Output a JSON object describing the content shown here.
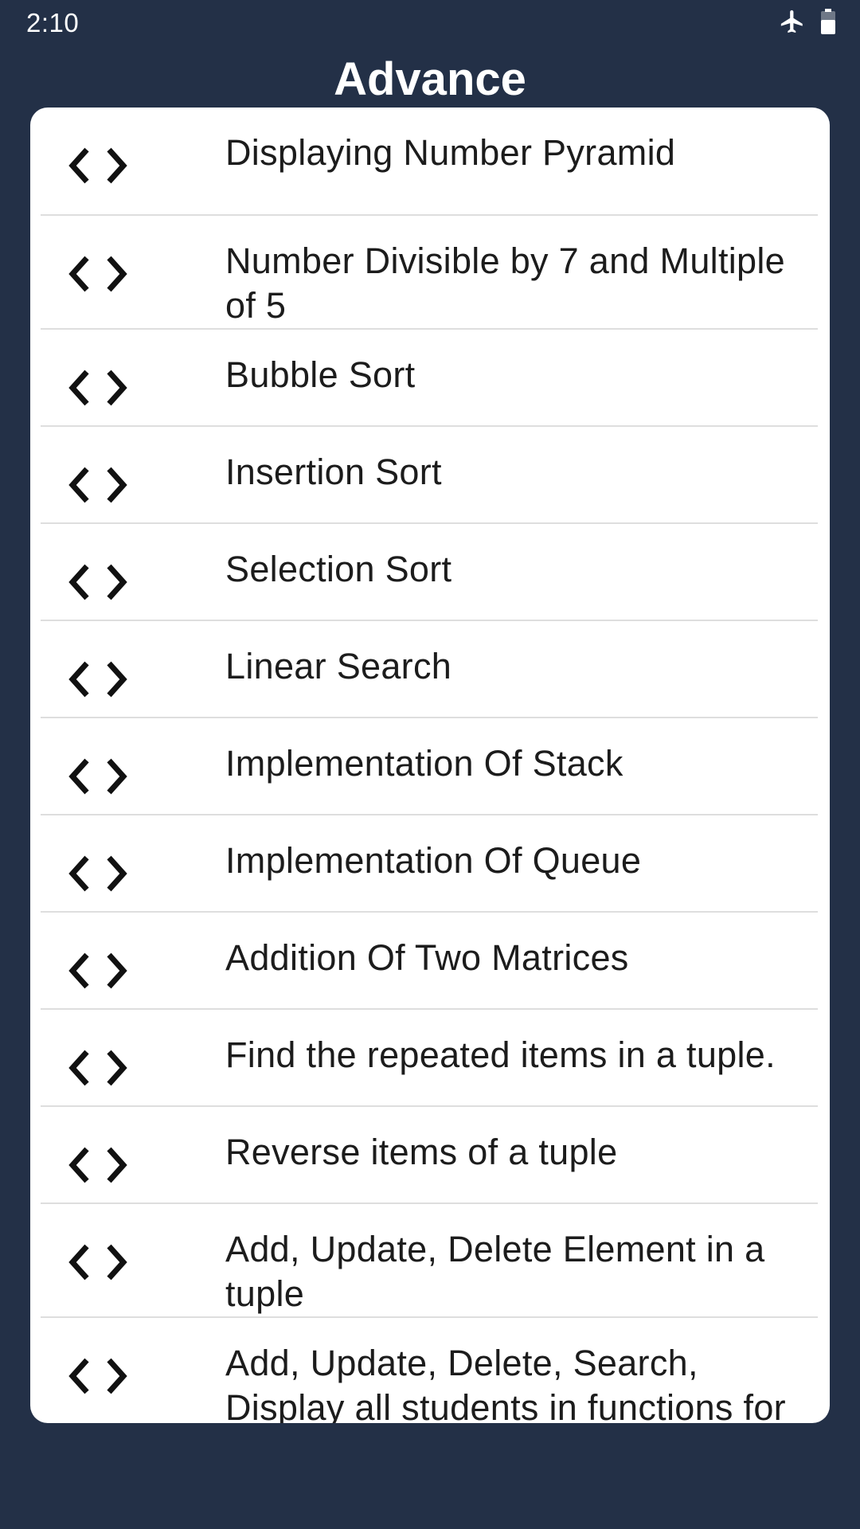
{
  "status_bar": {
    "time": "2:10",
    "icons": [
      "airplane-mode-icon",
      "battery-icon"
    ]
  },
  "header": {
    "title": "Advance"
  },
  "colors": {
    "background": "#233047",
    "card": "#ffffff",
    "text": "#1c1c1c",
    "divider": "#dedede"
  },
  "programs": [
    {
      "label": "Displaying Number Pyramid",
      "icon": "code-icon"
    },
    {
      "label": "Number Divisible by 7 and Multiple of 5",
      "icon": "code-icon"
    },
    {
      "label": "Bubble Sort",
      "icon": "code-icon"
    },
    {
      "label": "Insertion Sort",
      "icon": "code-icon"
    },
    {
      "label": "Selection Sort",
      "icon": "code-icon"
    },
    {
      "label": "Linear Search",
      "icon": "code-icon"
    },
    {
      "label": "Implementation Of Stack",
      "icon": "code-icon"
    },
    {
      "label": "Implementation Of Queue",
      "icon": "code-icon"
    },
    {
      "label": "Addition Of Two Matrices",
      "icon": "code-icon"
    },
    {
      "label": "Find the repeated items in a tuple.",
      "icon": "code-icon"
    },
    {
      "label": "Reverse items of a tuple",
      "icon": "code-icon"
    },
    {
      "label": "Add, Update, Delete Element in a tuple",
      "icon": "code-icon"
    },
    {
      "label": "Add, Update, Delete, Search, Display all students in functions for a file",
      "icon": "code-icon"
    }
  ]
}
